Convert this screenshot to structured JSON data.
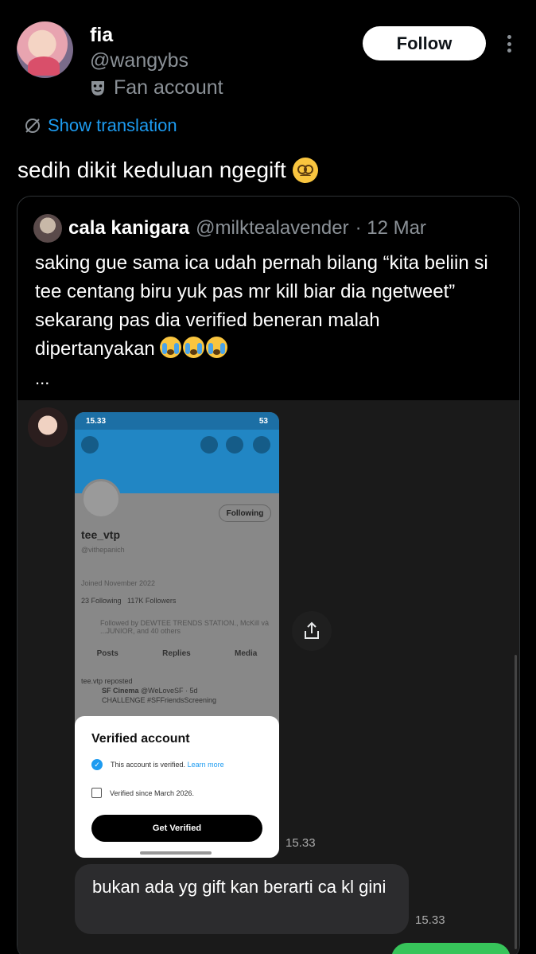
{
  "author": {
    "name": "fia",
    "handle": "@wangybs",
    "label": "Fan account",
    "follow_label": "Follow"
  },
  "translation_label": "Show translation",
  "tweet_text": "sedih dikit keduluan ngegift",
  "quote": {
    "name": "cala kanigara",
    "handle": "@milktealavender",
    "date": "· 12 Mar",
    "text": "saking gue sama ica udah pernah bilang “kita beliin si tee centang biru yuk pas mr kill biar dia ngetweet” sekarang pas dia verified beneran malah dipertanyakan",
    "ellipsis": "..."
  },
  "screenshot": {
    "status_time": "15.33",
    "status_battery": "53",
    "profile_name": "tee_vtp",
    "profile_handle": "@vithepanich",
    "following_label": "Following",
    "joined": "Joined November 2022",
    "following_count": "23 Following",
    "followers_count": "117K Followers",
    "followed_by": "Followed by DEWTEE TRENDS STATION., McKill và ...JUNIOR, and 40 others",
    "tabs": [
      "Posts",
      "Replies",
      "Media"
    ],
    "repost_label": "tee.vtp reposted",
    "post_author": "SF Cinema",
    "post_handle": "@WeLoveSF · 5d",
    "post_text": "CHALLENGE #SFFriendsScreening",
    "sheet_title": "Verified account",
    "sheet_verified": "This account is verified.",
    "sheet_learn_more": "Learn more",
    "sheet_since": "Verified since March 2026.",
    "sheet_button": "Get Verified"
  },
  "chat": {
    "time1": "15.33",
    "bubble_text": "bukan ada yg gift kan berarti ca kl gini",
    "time2": "15.33"
  },
  "colors": {
    "accent": "#1d9bf0",
    "background": "#000000",
    "secondary_text": "#8b9197"
  }
}
